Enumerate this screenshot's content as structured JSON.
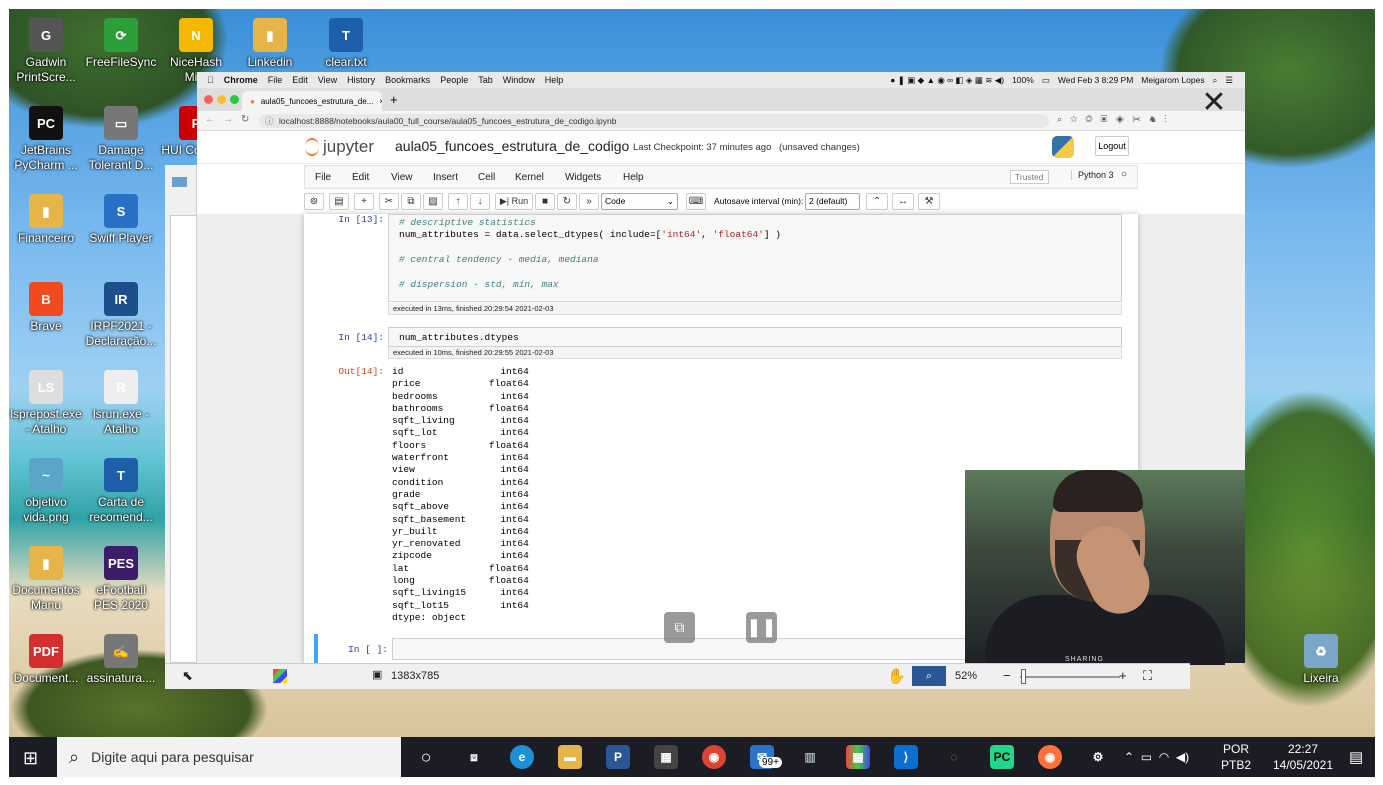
{
  "desktop_icons": [
    {
      "label": "Gadwin PrintScre...",
      "glyph": "G",
      "color": "#555"
    },
    {
      "label": "FreeFileSync",
      "glyph": "⟳",
      "color": "#2e9e3a"
    },
    {
      "label": "NiceHash Mi...",
      "glyph": "N",
      "color": "#f5b800"
    },
    {
      "label": "Linkedin",
      "glyph": "▮",
      "color": "#e6b54a"
    },
    {
      "label": "clear.txt",
      "glyph": "T",
      "color": "#1d5fa8"
    },
    {
      "label": "JetBrains PyCharm ...",
      "glyph": "PC",
      "color": "#111"
    },
    {
      "label": "Damage Tolerant D...",
      "glyph": "▭",
      "color": "#777"
    },
    {
      "label": "HUI Comm...",
      "glyph": "P",
      "color": "#c00"
    },
    {
      "label": "Financeiro",
      "glyph": "▮",
      "color": "#e6b54a"
    },
    {
      "label": "Swiff Player",
      "glyph": "S",
      "color": "#2a70c4"
    },
    {
      "label": "Brave",
      "glyph": "B",
      "color": "#f04a1e"
    },
    {
      "label": "IRPF2021 - Declaração...",
      "glyph": "IR",
      "color": "#1d4f8c"
    },
    {
      "label": "lsprepost.exe - Atalho",
      "glyph": "LS",
      "color": "#ddd"
    },
    {
      "label": "lsrun.exe - Atalho",
      "glyph": "R",
      "color": "#eee"
    },
    {
      "label": "objetivo vida.png",
      "glyph": "~",
      "color": "#5aa6c9"
    },
    {
      "label": "Carta de recomend...",
      "glyph": "T",
      "color": "#1d5fa8"
    },
    {
      "label": "Documentos Manu",
      "glyph": "▮",
      "color": "#e6b54a"
    },
    {
      "label": "eFootball PES 2020",
      "glyph": "PES",
      "color": "#3b1d6b"
    },
    {
      "label": "Document...",
      "glyph": "PDF",
      "color": "#d32f2f"
    },
    {
      "label": "assinatura....",
      "glyph": "✍",
      "color": "#777"
    },
    {
      "label": "Lixeira",
      "glyph": "♻",
      "color": "#7aa7c7"
    }
  ],
  "mac_menubar": {
    "apple": "",
    "app": "Chrome",
    "items": [
      "File",
      "Edit",
      "View",
      "History",
      "Bookmarks",
      "People",
      "Tab",
      "Window",
      "Help"
    ],
    "battery": "100%",
    "datetime": "Wed Feb 3  8:29 PM",
    "user": "Meigarom Lopes"
  },
  "browser": {
    "tab_title": "aula05_funcoes_estrutura_de...",
    "tab_close": "×",
    "new_tab": "+",
    "url": "localhost:8888/notebooks/aula00_full_course/aula05_funcoes_estrutura_de_codigo.ipynb"
  },
  "jupyter": {
    "logo_text": "jupyter",
    "notebook_title": "aula05_funcoes_estrutura_de_codigo",
    "checkpoint": "Last Checkpoint: 37 minutes ago",
    "unsaved": "(unsaved changes)",
    "logout": "Logout",
    "menu": [
      "File",
      "Edit",
      "View",
      "Insert",
      "Cell",
      "Kernel",
      "Widgets",
      "Help"
    ],
    "trusted": "Trusted",
    "kernel": "Python 3",
    "toolbar": {
      "run": "Run",
      "cell_type": "Code",
      "autosave_label": "Autosave interval (min):",
      "autosave_value": "2 (default)"
    }
  },
  "cells": {
    "c13": {
      "prompt": "In [13]:",
      "line1": "# descriptive statistics",
      "line2_a": "num_attributes = data.select_dtypes( include=[",
      "line2_s1": "'int64'",
      "line2_c": ", ",
      "line2_s2": "'float64'",
      "line2_d": "] )",
      "line3": "# central tendency - media, mediana",
      "line4": "# dispersion - std, min, max",
      "exec": "executed in 13ms, finished 20:29:54 2021-02-03"
    },
    "c14": {
      "prompt": "In [14]:",
      "code": "num_attributes.dtypes",
      "exec": "executed in 10ms, finished 20:29:55 2021-02-03",
      "out_prompt": "Out[14]:",
      "output": "id                 int64\nprice            float64\nbedrooms           int64\nbathrooms        float64\nsqft_living        int64\nsqft_lot           int64\nfloors           float64\nwaterfront         int64\nview               int64\ncondition          int64\ngrade              int64\nsqft_above         int64\nsqft_basement      int64\nyr_built           int64\nyr_renovated       int64\nzipcode            int64\nlat              float64\nlong             float64\nsqft_living15      int64\nsqft_lot15         int64\ndtype: object"
    },
    "c15": {
      "prompt": "In [ ]:"
    }
  },
  "viewer": {
    "close": "✕",
    "dimensions": "1383x785",
    "zoom": "52%",
    "zoom_minus": "−",
    "zoom_plus": "+"
  },
  "webcam": {
    "shirt_text": "SHARING"
  },
  "taskbar": {
    "search_placeholder": "Digite aqui para pesquisar",
    "mail_badge": "99+",
    "lang_top": "POR",
    "lang_bottom": "PTB2",
    "time": "22:27",
    "date": "14/05/2021"
  }
}
